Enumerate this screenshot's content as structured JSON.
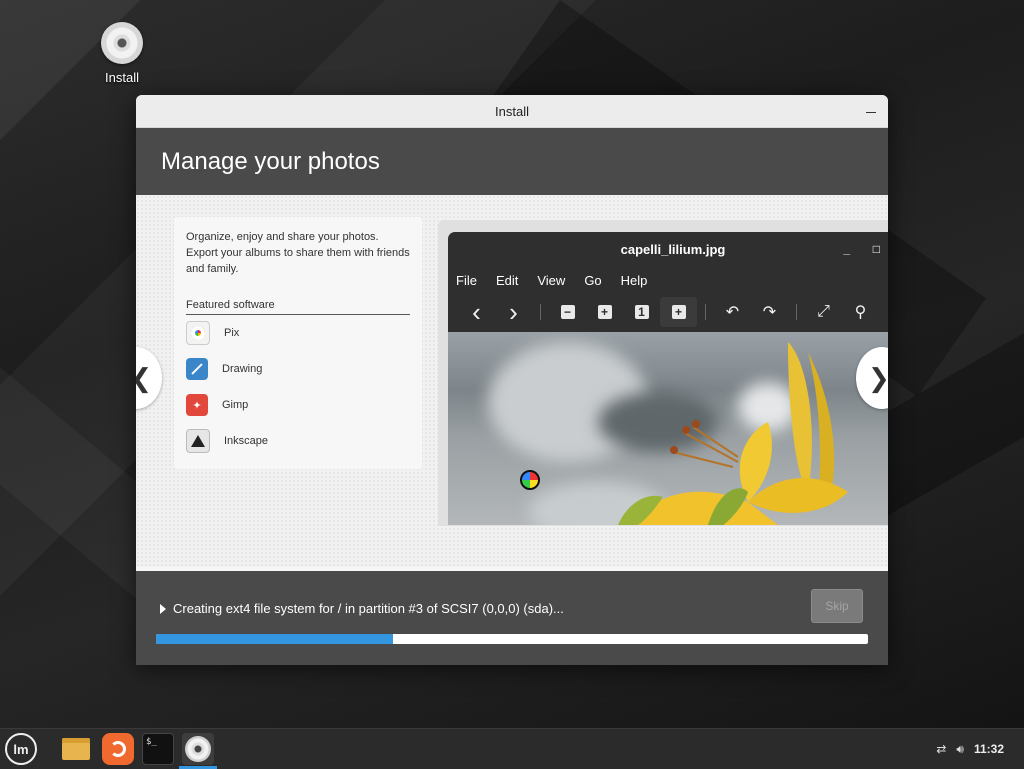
{
  "desktop": {
    "icon_label": "Install"
  },
  "window": {
    "title": "Install",
    "heading": "Manage your photos"
  },
  "slide": {
    "description": "Organize, enjoy and share your photos. Export your albums to share them with friends and family.",
    "featured_title": "Featured software",
    "apps": [
      {
        "label": "Pix",
        "icon": "pix-icon"
      },
      {
        "label": "Drawing",
        "icon": "drawing-icon"
      },
      {
        "label": "Gimp",
        "icon": "gimp-icon"
      },
      {
        "label": "Inkscape",
        "icon": "inkscape-icon"
      }
    ],
    "prev_symbol": "❮",
    "next_symbol": "❯"
  },
  "viewer": {
    "title": "capelli_lilium.jpg",
    "menu": [
      "File",
      "Edit",
      "View",
      "Go",
      "Help"
    ],
    "toolbar": {
      "back": "‹",
      "forward": "›",
      "zoom_out": "−",
      "zoom_in": "+",
      "zoom_normal": "1",
      "zoom_fit": "+",
      "rotate_left": "↶",
      "rotate_right": "↷",
      "fullscreen": "⤢",
      "slideshow": "⚲"
    }
  },
  "progress": {
    "status": "Creating ext4 file system for / in partition #3 of SCSI7 (0,0,0) (sda)...",
    "skip_label": "Skip",
    "fraction": 0.333,
    "bar_color": "#3496de"
  },
  "taskbar": {
    "menu_logo": "lm",
    "terminal_glyph": "$_",
    "clock": "11:32"
  }
}
